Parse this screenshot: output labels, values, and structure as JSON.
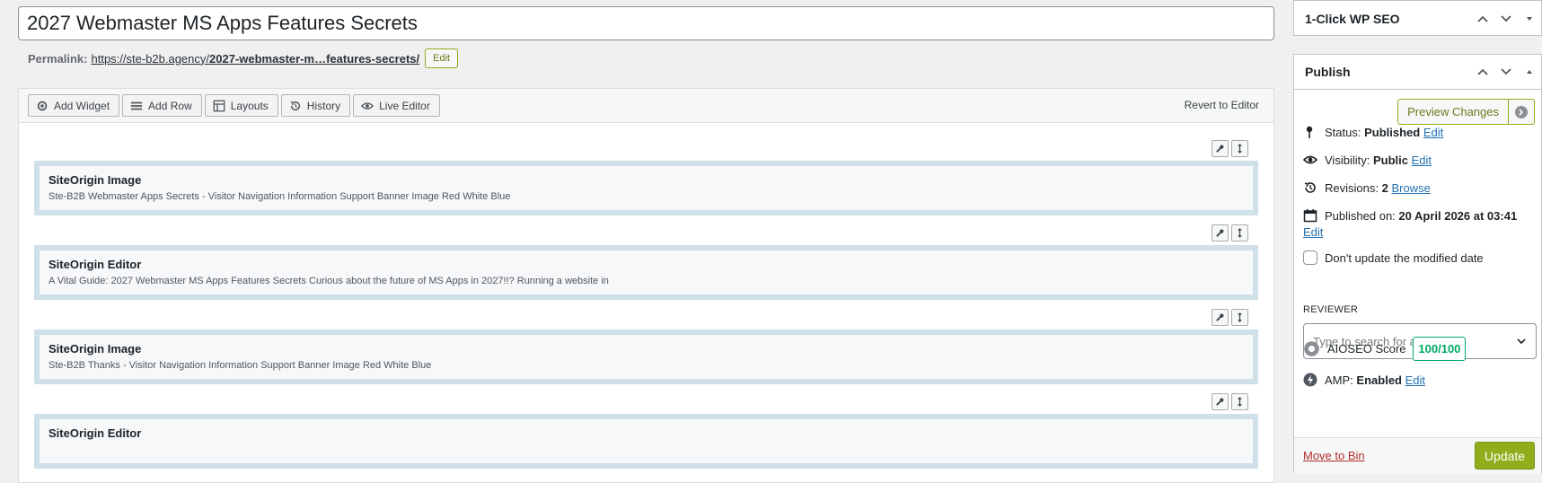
{
  "post": {
    "title": "2027 Webmaster MS Apps Features Secrets",
    "permalink_label": "Permalink:",
    "permalink_base": "https://ste-b2b.agency/",
    "permalink_slug": "2027-webmaster-m…features-secrets/",
    "permalink_edit": "Edit"
  },
  "toolbar": {
    "buttons": [
      {
        "label": "Add Widget",
        "icon": "gear-icon"
      },
      {
        "label": "Add Row",
        "icon": "menu-icon"
      },
      {
        "label": "Layouts",
        "icon": "layout-icon"
      },
      {
        "label": "History",
        "icon": "history-icon"
      },
      {
        "label": "Live Editor",
        "icon": "eye-icon"
      }
    ],
    "revert": "Revert to Editor"
  },
  "rows": [
    {
      "title": "SiteOrigin Image",
      "desc": "Ste-B2B Webmaster Apps Secrets - Visitor Navigation Information Support Banner Image Red White Blue"
    },
    {
      "title": "SiteOrigin Editor",
      "desc": "A Vital Guide: 2027 Webmaster MS Apps Features Secrets Curious about the future of MS Apps in 2027!!? Running a website in"
    },
    {
      "title": "SiteOrigin Image",
      "desc": "Ste-B2B Thanks - Visitor Navigation Information Support Banner Image Red White Blue"
    },
    {
      "title": "SiteOrigin Editor",
      "desc": ""
    }
  ],
  "seo_box": {
    "title": "1-Click WP SEO"
  },
  "publish": {
    "title": "Publish",
    "preview": "Preview Changes",
    "status_label": "Status:",
    "status_value": "Published",
    "visibility_label": "Visibility:",
    "visibility_value": "Public",
    "revisions_label": "Revisions:",
    "revisions_value": "2",
    "browse": "Browse",
    "published_label": "Published on:",
    "published_value": "20 April 2026 at 03:41",
    "edit": "Edit",
    "dont_update": "Don't update the modified date",
    "reviewer_label": "REVIEWER",
    "reviewer_placeholder": "Type to search for a reviewer",
    "aioseo_label": "AIOSEO Score",
    "aioseo_score": "100/100",
    "amp_label": "AMP:",
    "amp_value": "Enabled",
    "trash": "Move to Bin",
    "update": "Update"
  },
  "colors": {
    "accent": "#8fae1b",
    "link": "#2271b1",
    "trash": "#b32d2e",
    "score": "#00aa63"
  }
}
